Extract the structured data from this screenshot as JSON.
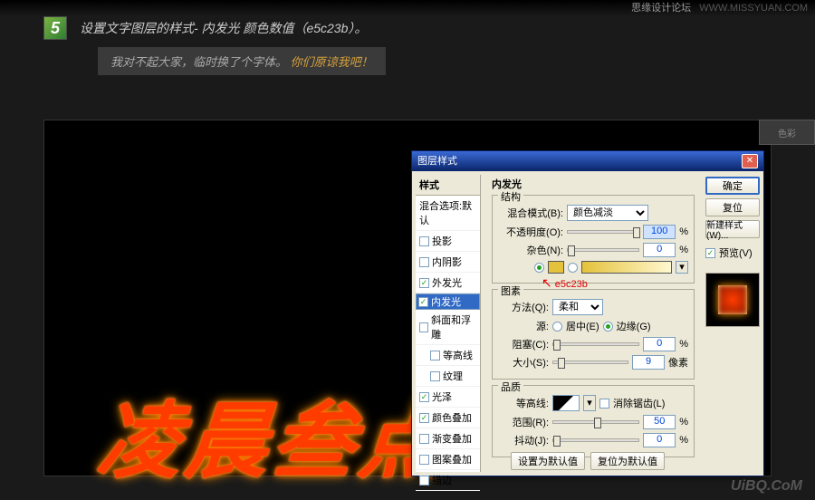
{
  "topbar": {
    "site": "思缘设计论坛",
    "url": "WWW.MISSYUAN.COM"
  },
  "step": {
    "num": "5",
    "text": "设置文字图层的样式- 内发光 颜色数值（e5c23b）。"
  },
  "quote": {
    "a": "我对不起大家，临时换了个字体。",
    "b": "你们原谅我吧！"
  },
  "glow_text": "凌晨叁点",
  "right_panel": "色彩",
  "dialog": {
    "title": "图层样式",
    "close": "✕",
    "left": {
      "header": "样式",
      "default": "混合选项:默认",
      "items": [
        {
          "label": "投影",
          "chk": false
        },
        {
          "label": "内阴影",
          "chk": false
        },
        {
          "label": "外发光",
          "chk": true
        },
        {
          "label": "内发光",
          "chk": true,
          "sel": true
        },
        {
          "label": "斜面和浮雕",
          "chk": false
        },
        {
          "label": "等高线",
          "chk": false,
          "sub": true
        },
        {
          "label": "纹理",
          "chk": false,
          "sub": true
        },
        {
          "label": "光泽",
          "chk": true
        },
        {
          "label": "颜色叠加",
          "chk": true
        },
        {
          "label": "渐变叠加",
          "chk": false
        },
        {
          "label": "图案叠加",
          "chk": false
        },
        {
          "label": "描边",
          "chk": false
        }
      ]
    },
    "section_title": "内发光",
    "groups": {
      "structure": {
        "title": "结构",
        "blend_label": "混合模式(B):",
        "blend_value": "颜色减淡",
        "opacity_label": "不透明度(O):",
        "opacity_value": "100",
        "opacity_unit": "%",
        "noise_label": "杂色(N):",
        "noise_value": "0",
        "noise_unit": "%",
        "swatch_color": "#e5c23b",
        "annotation": "e5c23b"
      },
      "elements": {
        "title": "图素",
        "tech_label": "方法(Q):",
        "tech_value": "柔和",
        "source_label": "源:",
        "center": "居中(E)",
        "edge": "边缘(G)",
        "choke_label": "阻塞(C):",
        "choke_value": "0",
        "choke_unit": "%",
        "size_label": "大小(S):",
        "size_value": "9",
        "size_unit": "像素"
      },
      "quality": {
        "title": "品质",
        "contour_label": "等高线:",
        "anti": "消除锯齿(L)",
        "range_label": "范围(R):",
        "range_value": "50",
        "range_unit": "%",
        "jitter_label": "抖动(J):",
        "jitter_value": "0",
        "jitter_unit": "%"
      }
    },
    "bottom": {
      "set_default": "设置为默认值",
      "reset_default": "复位为默认值"
    },
    "right": {
      "ok": "确定",
      "cancel": "复位",
      "new_style": "新建样式(W)...",
      "preview_chk": "预览(V)"
    }
  },
  "watermark": "UiBQ.CoM"
}
